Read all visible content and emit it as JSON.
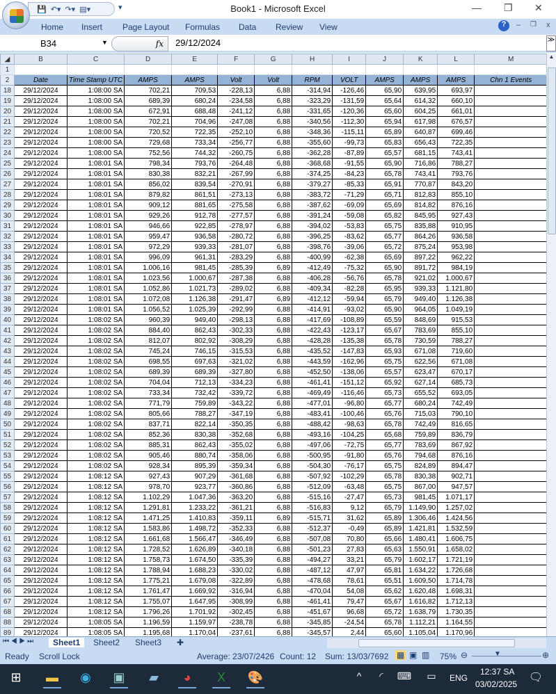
{
  "window": {
    "title": "Book1 - Microsoft Excel"
  },
  "ribbon": {
    "tabs": [
      "Home",
      "Insert",
      "Page Layout",
      "Formulas",
      "Data",
      "Review",
      "View"
    ]
  },
  "formula_bar": {
    "name_box": "B34",
    "fx": "fx",
    "value": "29/12/2024"
  },
  "columns": [
    "B",
    "C",
    "D",
    "E",
    "F",
    "G",
    "H",
    "I",
    "J",
    "K",
    "L",
    "M"
  ],
  "headers": [
    "Date",
    "Time Stamp UTC",
    "AMPS",
    "AMPS",
    "Volt",
    "Volt",
    "RPM",
    "VOLT",
    "AMPS",
    "AMPS",
    "AMPS",
    "Chn 1 Events"
  ],
  "rows": [
    [
      "18",
      "29/12/2024",
      "1:08:00 SA",
      "702,21",
      "709,53",
      "-228,13",
      "6,88",
      "-314,94",
      "-126,46",
      "65,90",
      "639,95",
      "693,97"
    ],
    [
      "19",
      "29/12/2024",
      "1:08:00 SA",
      "689,39",
      "680,24",
      "-234,58",
      "6,88",
      "-323,29",
      "-131,59",
      "65,64",
      "614,32",
      "660,10"
    ],
    [
      "20",
      "29/12/2024",
      "1:08:00 SA",
      "672,91",
      "688,48",
      "-241,12",
      "6,88",
      "-331,65",
      "-120,36",
      "65,60",
      "604,25",
      "661,01"
    ],
    [
      "21",
      "29/12/2024",
      "1:08:00 SA",
      "702,21",
      "704,96",
      "-247,08",
      "6,88",
      "-340,56",
      "-112,30",
      "65,94",
      "617,98",
      "676,57"
    ],
    [
      "22",
      "29/12/2024",
      "1:08:00 SA",
      "720,52",
      "722,35",
      "-252,10",
      "6,88",
      "-348,36",
      "-115,11",
      "65,89",
      "640,87",
      "699,46"
    ],
    [
      "23",
      "29/12/2024",
      "1:08:00 SA",
      "729,68",
      "733,34",
      "-256,77",
      "6,88",
      "-355,60",
      "-99,73",
      "65,83",
      "656,43",
      "722,35"
    ],
    [
      "24",
      "29/12/2024",
      "1:08:00 SA",
      "752,56",
      "744,32",
      "-260,75",
      "6,88",
      "-362,28",
      "-87,89",
      "65,57",
      "681,15",
      "743,41"
    ],
    [
      "25",
      "29/12/2024",
      "1:08:01 SA",
      "798,34",
      "793,76",
      "-264,48",
      "6,88",
      "-368,68",
      "-91,55",
      "65,90",
      "716,86",
      "788,27"
    ],
    [
      "26",
      "29/12/2024",
      "1:08:01 SA",
      "830,38",
      "832,21",
      "-267,99",
      "6,88",
      "-374,25",
      "-84,23",
      "65,78",
      "743,41",
      "793,76"
    ],
    [
      "27",
      "29/12/2024",
      "1:08:01 SA",
      "856,02",
      "839,54",
      "-270,91",
      "6,88",
      "-379,27",
      "-85,33",
      "65,91",
      "770,87",
      "843,20"
    ],
    [
      "28",
      "29/12/2024",
      "1:08:01 SA",
      "879,82",
      "861,51",
      "-273,13",
      "6,88",
      "-383,72",
      "-71,29",
      "65,71",
      "812,83",
      "855,10"
    ],
    [
      "29",
      "29/12/2024",
      "1:08:01 SA",
      "909,12",
      "881,65",
      "-275,58",
      "6,88",
      "-387,62",
      "-69,09",
      "65,69",
      "814,82",
      "876,16"
    ],
    [
      "30",
      "29/12/2024",
      "1:08:01 SA",
      "929,26",
      "912,78",
      "-277,57",
      "6,88",
      "-391,24",
      "-59,08",
      "65,82",
      "845,95",
      "927,43"
    ],
    [
      "31",
      "29/12/2024",
      "1:08:01 SA",
      "946,66",
      "922,85",
      "-278,97",
      "6,88",
      "-394,02",
      "-53,83",
      "65,75",
      "835,88",
      "910,95"
    ],
    [
      "32",
      "29/12/2024",
      "1:08:01 SA",
      "959,47",
      "936,58",
      "-280,72",
      "6,88",
      "-396,25",
      "-83,62",
      "65,77",
      "864,26",
      "936,58"
    ],
    [
      "33",
      "29/12/2024",
      "1:08:01 SA",
      "972,29",
      "939,33",
      "-281,07",
      "6,88",
      "-398,76",
      "-39,06",
      "65,72",
      "875,24",
      "953,98"
    ],
    [
      "34",
      "29/12/2024",
      "1:08:01 SA",
      "996,09",
      "961,31",
      "-283,29",
      "6,88",
      "-400,99",
      "-62,38",
      "65,69",
      "897,22",
      "962,22"
    ],
    [
      "35",
      "29/12/2024",
      "1:08:01 SA",
      "1.006,16",
      "981,45",
      "-285,39",
      "6,89",
      "-412,49",
      "-75,32",
      "65,90",
      "891,72",
      "984,19"
    ],
    [
      "36",
      "29/12/2024",
      "1:08:01 SA",
      "1.023,56",
      "1.000,67",
      "-287,38",
      "6,88",
      "-406,28",
      "-56,76",
      "65,78",
      "921,02",
      "1.000,67"
    ],
    [
      "37",
      "29/12/2024",
      "1:08:01 SA",
      "1.052,86",
      "1.021,73",
      "-289,02",
      "6,88",
      "-409,34",
      "-82,28",
      "65,95",
      "939,33",
      "1.121,80"
    ],
    [
      "38",
      "29/12/2024",
      "1:08:01 SA",
      "1.072,08",
      "1.126,38",
      "-291,47",
      "6,89",
      "-412,12",
      "-59,94",
      "65,79",
      "949,40",
      "1.126,38"
    ],
    [
      "39",
      "29/12/2024",
      "1:08:01 SA",
      "1.056,52",
      "1.025,39",
      "-292,99",
      "6,88",
      "-414,91",
      "-93,02",
      "65,90",
      "964,05",
      "1.049,19"
    ],
    [
      "40",
      "29/12/2024",
      "1:08:02 SA",
      "960,39",
      "949,40",
      "-298,13",
      "6,88",
      "-417,69",
      "-108,89",
      "65,59",
      "848,69",
      "915,53"
    ],
    [
      "41",
      "29/12/2024",
      "1:08:02 SA",
      "884,40",
      "862,43",
      "-302,33",
      "6,88",
      "-422,43",
      "-123,17",
      "65,67",
      "783,69",
      "855,10"
    ],
    [
      "42",
      "29/12/2024",
      "1:08:02 SA",
      "812,07",
      "802,92",
      "-308,29",
      "6,88",
      "-428,28",
      "-135,38",
      "65,78",
      "730,59",
      "788,27"
    ],
    [
      "43",
      "29/12/2024",
      "1:08:02 SA",
      "745,24",
      "746,15",
      "-315,53",
      "6,88",
      "-435,52",
      "-147,83",
      "65,93",
      "671,08",
      "719,60"
    ],
    [
      "44",
      "29/12/2024",
      "1:08:02 SA",
      "698,55",
      "697,63",
      "-321,02",
      "6,88",
      "-443,59",
      "-162,96",
      "65,75",
      "622,56",
      "671,08"
    ],
    [
      "45",
      "29/12/2024",
      "1:08:02 SA",
      "689,39",
      "689,39",
      "-327,80",
      "6,88",
      "-452,50",
      "-138,06",
      "65,57",
      "623,47",
      "670,17"
    ],
    [
      "46",
      "29/12/2024",
      "1:08:02 SA",
      "704,04",
      "712,13",
      "-334,23",
      "6,88",
      "-461,41",
      "-151,12",
      "65,92",
      "627,14",
      "685,73"
    ],
    [
      "47",
      "29/12/2024",
      "1:08:02 SA",
      "733,34",
      "732,42",
      "-339,72",
      "6,88",
      "-469,49",
      "-116,46",
      "65,73",
      "655,52",
      "693,05"
    ],
    [
      "48",
      "29/12/2024",
      "1:08:02 SA",
      "771,79",
      "759,89",
      "-343,22",
      "6,88",
      "-477,01",
      "-96,80",
      "65,77",
      "680,24",
      "742,49"
    ],
    [
      "49",
      "29/12/2024",
      "1:08:02 SA",
      "805,66",
      "788,27",
      "-347,19",
      "6,88",
      "-483,41",
      "-100,46",
      "65,76",
      "715,03",
      "790,10"
    ],
    [
      "50",
      "29/12/2024",
      "1:08:02 SA",
      "837,71",
      "822,14",
      "-350,35",
      "6,88",
      "-488,42",
      "-98,63",
      "65,78",
      "742,49",
      "816,65"
    ],
    [
      "51",
      "29/12/2024",
      "1:08:02 SA",
      "852,36",
      "830,38",
      "-352,68",
      "6,88",
      "-493,16",
      "-104,25",
      "65,68",
      "759,89",
      "836,79"
    ],
    [
      "52",
      "29/12/2024",
      "1:08:02 SA",
      "885,31",
      "862,43",
      "-355,02",
      "6,88",
      "-497,06",
      "-72,75",
      "65,77",
      "783,69",
      "867,92"
    ],
    [
      "53",
      "29/12/2024",
      "1:08:02 SA",
      "905,46",
      "880,74",
      "-358,06",
      "6,88",
      "-500,95",
      "-91,80",
      "65,76",
      "794,68",
      "876,16"
    ],
    [
      "54",
      "29/12/2024",
      "1:08:02 SA",
      "928,34",
      "895,39",
      "-359,34",
      "6,88",
      "-504,30",
      "-76,17",
      "65,75",
      "824,89",
      "894,47"
    ],
    [
      "55",
      "29/12/2024",
      "1:08:12 SA",
      "927,43",
      "907,29",
      "-361,68",
      "6,88",
      "-507,92",
      "-102,29",
      "65,78",
      "830,38",
      "902,71"
    ],
    [
      "56",
      "29/12/2024",
      "1:08:12 SA",
      "978,70",
      "923,77",
      "-360,86",
      "6,88",
      "-512,09",
      "-63,48",
      "65,75",
      "867,00",
      "947,57"
    ],
    [
      "57",
      "29/12/2024",
      "1:08:12 SA",
      "1.102,29",
      "1.047,36",
      "-363,20",
      "6,88",
      "-515,16",
      "-27,47",
      "65,73",
      "981,45",
      "1.071,17"
    ],
    [
      "58",
      "29/12/2024",
      "1:08:12 SA",
      "1.291,81",
      "1.233,22",
      "-361,21",
      "6,88",
      "-516,83",
      "9,12",
      "65,79",
      "1.149,90",
      "1.257,02"
    ],
    [
      "59",
      "29/12/2024",
      "1:08:12 SA",
      "1.471,25",
      "1.410,83",
      "-359,11",
      "6,89",
      "-515,71",
      "31,62",
      "65,89",
      "1.306,46",
      "1.424,56"
    ],
    [
      "60",
      "29/12/2024",
      "1:08:12 SA",
      "1.583,86",
      "1.498,72",
      "-352,33",
      "6,88",
      "-512,37",
      "-0,49",
      "65,89",
      "1.421,81",
      "1.532,59"
    ],
    [
      "61",
      "29/12/2024",
      "1:08:12 SA",
      "1.661,68",
      "1.566,47",
      "-346,49",
      "6,88",
      "-507,08",
      "70,80",
      "65,66",
      "1.480,41",
      "1.606,75"
    ],
    [
      "62",
      "29/12/2024",
      "1:08:12 SA",
      "1.728,52",
      "1.626,89",
      "-340,18",
      "6,88",
      "-501,23",
      "27,83",
      "65,63",
      "1.550,91",
      "1.658,02"
    ],
    [
      "63",
      "29/12/2024",
      "1:08:12 SA",
      "1.758,73",
      "1.674,50",
      "-335,39",
      "6,88",
      "-494,27",
      "33,21",
      "65,79",
      "1.602,17",
      "1.721,19"
    ],
    [
      "64",
      "29/12/2024",
      "1:08:12 SA",
      "1.788,94",
      "1.688,23",
      "-330,02",
      "6,88",
      "-487,12",
      "47,97",
      "65,81",
      "1.634,22",
      "1.726,68"
    ],
    [
      "65",
      "29/12/2024",
      "1:08:12 SA",
      "1.775,21",
      "1.679,08",
      "-322,89",
      "6,88",
      "-478,68",
      "78,61",
      "65,51",
      "1.609,50",
      "1.714,78"
    ],
    [
      "66",
      "29/12/2024",
      "1:08:12 SA",
      "1.761,47",
      "1.669,92",
      "-316,94",
      "6,88",
      "-470,04",
      "54,08",
      "65,62",
      "1.620,48",
      "1.698,31"
    ],
    [
      "67",
      "29/12/2024",
      "1:08:12 SA",
      "1.755,07",
      "1.647,95",
      "-308,99",
      "6,88",
      "-461,41",
      "79,47",
      "65,67",
      "1.616,82",
      "1.712,13"
    ],
    [
      "68",
      "29/12/2024",
      "1:08:12 SA",
      "1.796,26",
      "1.701,92",
      "-302,45",
      "6,88",
      "-451,67",
      "96,68",
      "65,72",
      "1.638,79",
      "1.730,35"
    ],
    [
      "88",
      "29/12/2024",
      "1:08:05 SA",
      "1.196,59",
      "1.159,97",
      "-238,78",
      "6,88",
      "-345,85",
      "-24,54",
      "65,78",
      "1.112,21",
      "1.164,55"
    ],
    [
      "89",
      "29/12/2024",
      "1:08:05 SA",
      "1.195,68",
      "1.170,04",
      "-237,61",
      "6,88",
      "-345,57",
      "2,44",
      "65,60",
      "1.105,04",
      "1.170,96"
    ]
  ],
  "sheets": [
    "Sheet1",
    "Sheet2",
    "Sheet3"
  ],
  "status": {
    "ready": "Ready",
    "scroll_lock": "Scroll Lock",
    "average": "Average: 23/07/2426",
    "count": "Count: 12",
    "sum": "Sum: 13/03/7692",
    "zoom": "75%"
  },
  "taskbar": {
    "lang": "ENG",
    "time": "12:37 SA",
    "date": "03/02/2025"
  }
}
